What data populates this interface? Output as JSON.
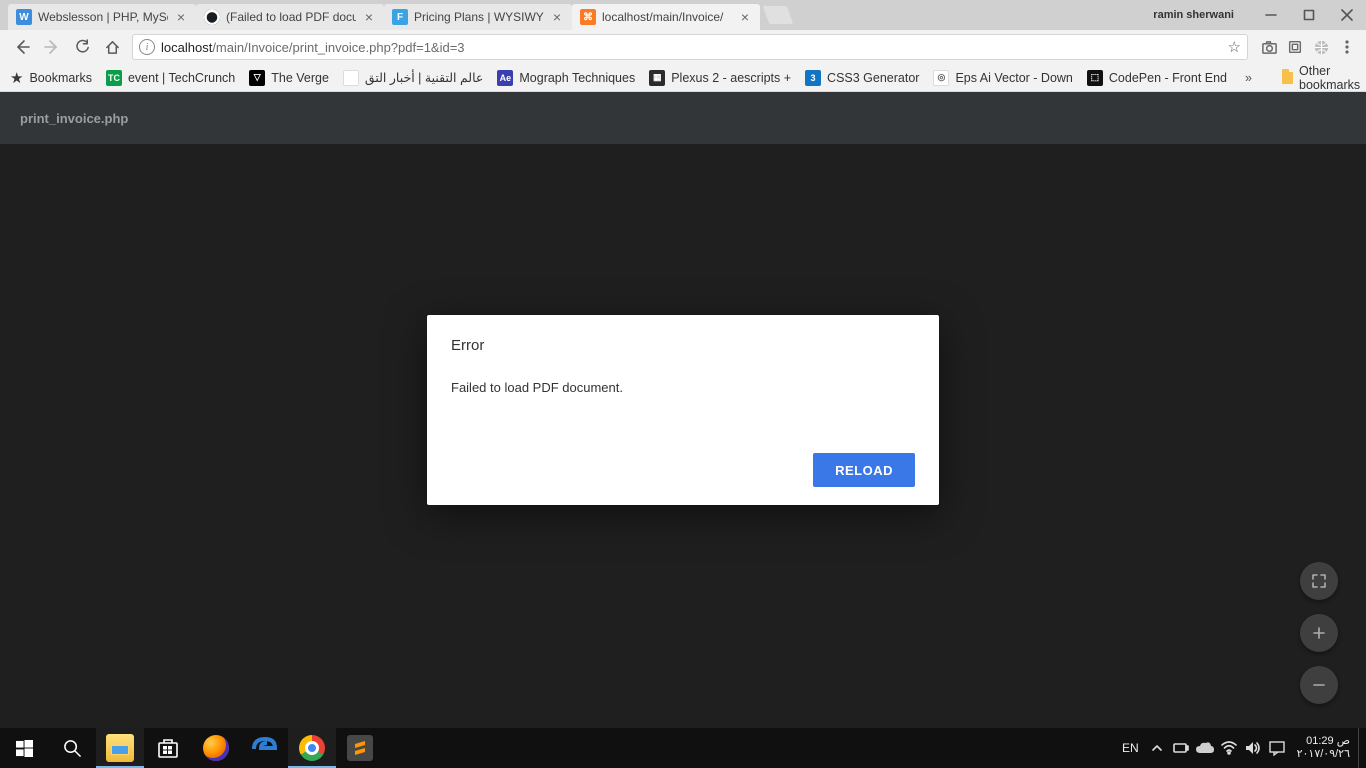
{
  "window": {
    "profile_name": "ramin sherwani"
  },
  "tabs": [
    {
      "title": "Webslesson | PHP, MySql",
      "favicon_bg": "#3b8dde",
      "favicon_text": "W",
      "active": false
    },
    {
      "title": "(Failed to load PDF document",
      "favicon_bg": "#1b1f23",
      "favicon_text": "⬤",
      "active": false
    },
    {
      "title": "Pricing Plans | WYSIWYG",
      "favicon_bg": "#3aa3e3",
      "favicon_text": "F",
      "active": false
    },
    {
      "title": "localhost/main/Invoice/",
      "favicon_bg": "#fb7a24",
      "favicon_text": "⌘",
      "active": true
    }
  ],
  "toolbar": {
    "url_host": "localhost",
    "url_path": "/main/Invoice/print_invoice.php?pdf=1&id=3"
  },
  "bookmarks": {
    "label": "Bookmarks",
    "items": [
      {
        "label": "event | TechCrunch",
        "bg": "#0a9e4a",
        "text": "TC"
      },
      {
        "label": "The Verge",
        "bg": "#000000",
        "text": "▽"
      },
      {
        "label": "عالم التقنية | أخبار التق",
        "bg": "#ffffff",
        "text": ""
      },
      {
        "label": "Mograph Techniques",
        "bg": "#3a3fb0",
        "text": "Ae"
      },
      {
        "label": "Plexus 2 - aescripts +",
        "bg": "#2b2b2b",
        "text": "▦"
      },
      {
        "label": "CSS3 Generator",
        "bg": "#1474c4",
        "text": "3"
      },
      {
        "label": "Eps Ai Vector - Down",
        "bg": "#ffffff",
        "text": "◎"
      },
      {
        "label": "CodePen - Front End",
        "bg": "#111111",
        "text": "⬚"
      }
    ],
    "other": "Other bookmarks"
  },
  "viewer": {
    "doc_name": "print_invoice.php",
    "dialog_title": "Error",
    "dialog_message": "Failed to load PDF document.",
    "dialog_button": "RELOAD"
  },
  "taskbar": {
    "lang": "EN",
    "time": "01:29",
    "ampm": "ص",
    "date": "٢٠١٧/٠٩/٢٦"
  }
}
